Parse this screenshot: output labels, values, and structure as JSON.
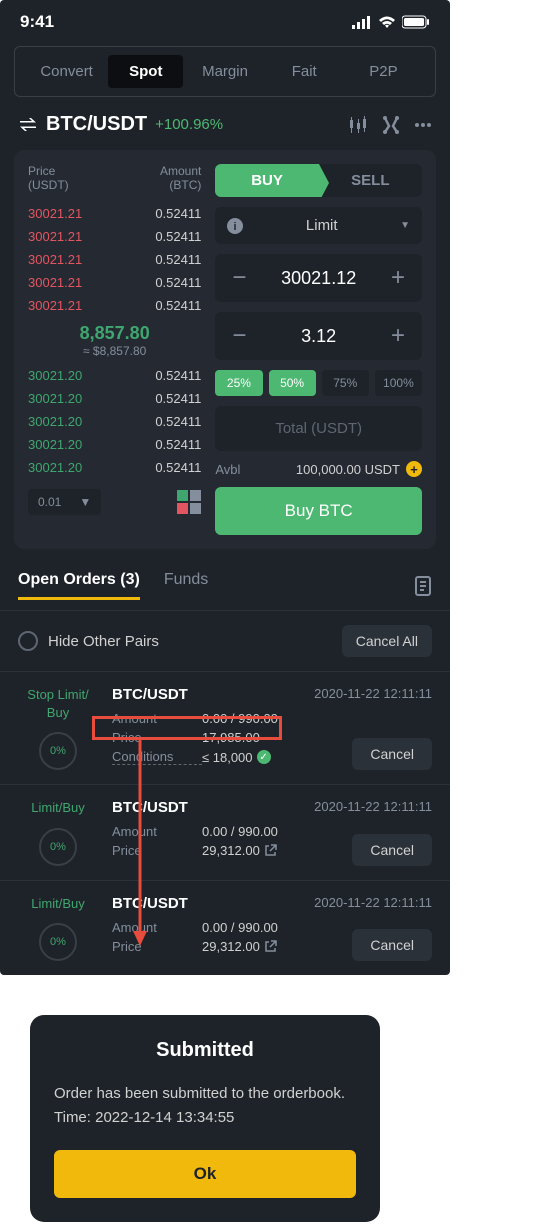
{
  "status": {
    "time": "9:41"
  },
  "tabs": [
    "Convert",
    "Spot",
    "Margin",
    "Fait",
    "P2P"
  ],
  "active_tab_index": 1,
  "pair": {
    "name": "BTC/USDT",
    "change": "+100.96%"
  },
  "orderbook": {
    "price_label": "Price",
    "price_unit": "(USDT)",
    "amount_label": "Amount",
    "amount_unit": "(BTC)",
    "asks": [
      {
        "p": "30021.21",
        "a": "0.52411"
      },
      {
        "p": "30021.21",
        "a": "0.52411"
      },
      {
        "p": "30021.21",
        "a": "0.52411"
      },
      {
        "p": "30021.21",
        "a": "0.52411"
      },
      {
        "p": "30021.21",
        "a": "0.52411"
      }
    ],
    "mid_price": "8,857.80",
    "mid_sub": "≈ $8,857.80",
    "bids": [
      {
        "p": "30021.20",
        "a": "0.52411"
      },
      {
        "p": "30021.20",
        "a": "0.52411"
      },
      {
        "p": "30021.20",
        "a": "0.52411"
      },
      {
        "p": "30021.20",
        "a": "0.52411"
      },
      {
        "p": "30021.20",
        "a": "0.52411"
      }
    ],
    "tick": "0.01"
  },
  "trade": {
    "buy_label": "BUY",
    "sell_label": "SELL",
    "order_type": "Limit",
    "price": "30021.12",
    "amount": "3.12",
    "percents": [
      "25%",
      "50%",
      "75%",
      "100%"
    ],
    "percent_active": [
      true,
      true,
      false,
      false
    ],
    "total_label": "Total (USDT)",
    "avbl_label": "Avbl",
    "avbl_value": "100,000.00 USDT",
    "submit_label": "Buy BTC"
  },
  "orders_header": {
    "open_label": "Open Orders (3)",
    "funds_label": "Funds",
    "hide_label": "Hide Other Pairs",
    "cancel_all": "Cancel All"
  },
  "orders": [
    {
      "type": "Stop Limit/\nBuy",
      "pct": "0%",
      "pair": "BTC/USDT",
      "time": "2020-11-22  12:11:11",
      "amount_label": "Amount",
      "amount_val": "0.00 / 990.00",
      "price_label": "Price",
      "price_val": "17,985.00",
      "cond_label": "Conditions",
      "cond_val": "≤ 18,000",
      "has_check": true,
      "has_share": false,
      "cancel": "Cancel"
    },
    {
      "type": "Limit/Buy",
      "pct": "0%",
      "pair": "BTC/USDT",
      "time": "2020-11-22  12:11:11",
      "amount_label": "Amount",
      "amount_val": "0.00 / 990.00",
      "price_label": "Price",
      "price_val": "29,312.00",
      "has_check": false,
      "has_share": true,
      "cancel": "Cancel"
    },
    {
      "type": "Limit/Buy",
      "pct": "0%",
      "pair": "BTC/USDT",
      "time": "2020-11-22  12:11:11",
      "amount_label": "Amount",
      "amount_val": "0.00 / 990.00",
      "price_label": "Price",
      "price_val": "29,312.00",
      "has_check": false,
      "has_share": true,
      "cancel": "Cancel"
    }
  ],
  "dialog": {
    "title": "Submitted",
    "line1": "Order has been submitted to the orderbook.",
    "line2": "Time: 2022-12-14 13:34:55",
    "ok": "Ok"
  }
}
